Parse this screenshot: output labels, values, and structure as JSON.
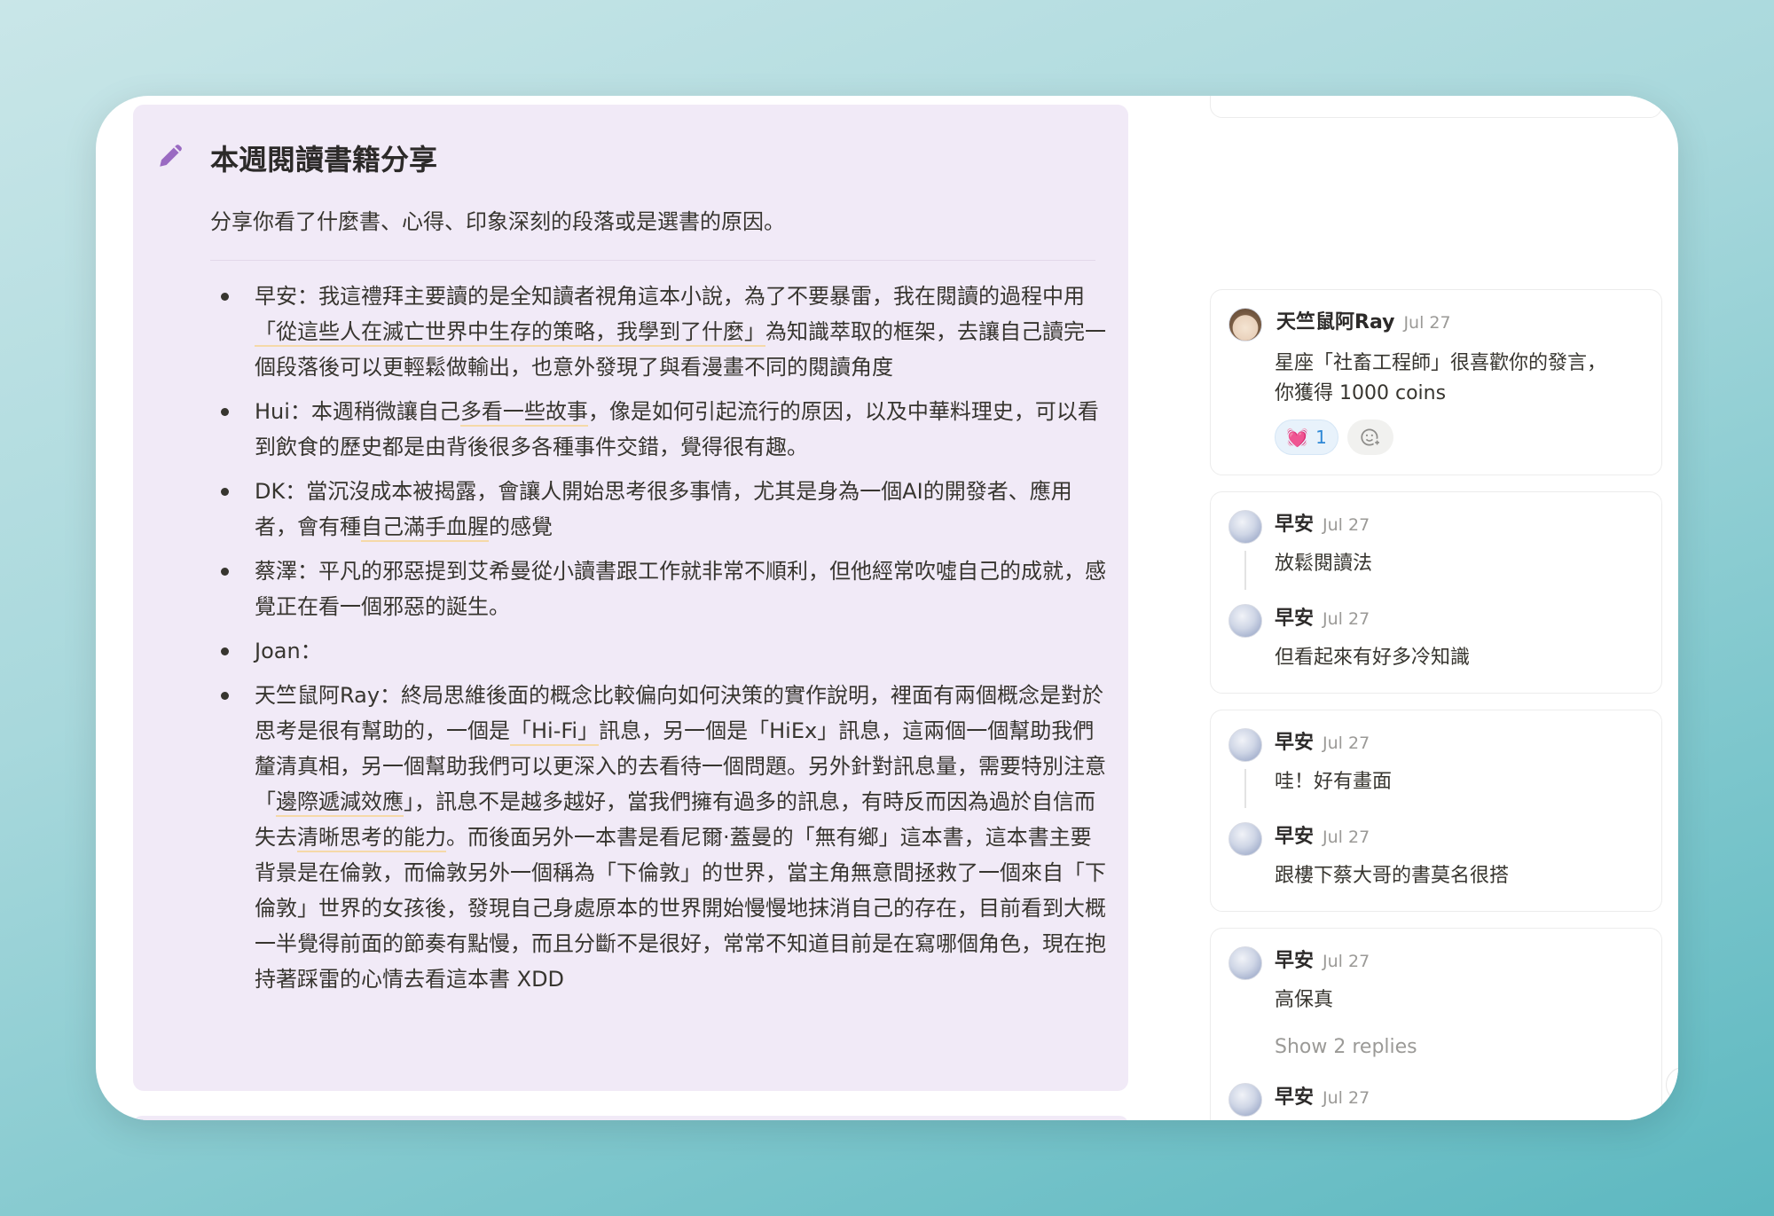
{
  "callout": {
    "title": "本週閱讀書籍分享",
    "subtitle": "分享你看了什麼書、心得、印象深刻的段落或是選書的原因。",
    "icon": "pencil-icon",
    "bullets": [
      {
        "parts": [
          {
            "t": "早安：我這禮拜主要讀的是全知讀者視角這本小說，為了不要暴雷，我在閱讀的過程中用"
          },
          {
            "t": "「從這些人在滅亡世界中生存的策略，我學到了什麼」",
            "h": true
          },
          {
            "t": "為知識萃取的框架，去讓自己讀完一個段落後可以更輕鬆做輸出，也意外發現了與看漫畫不同的閱讀角度"
          }
        ]
      },
      {
        "parts": [
          {
            "t": "Hui：本週稍微讓自己"
          },
          {
            "t": "多看一些故事",
            "h": true
          },
          {
            "t": "，像是如何引起流行的原因，以及中華料理史，可以看到飲食的歷史都是由背後很多各種事件交錯，覺得很有趣。"
          }
        ]
      },
      {
        "parts": [
          {
            "t": "DK：當沉沒成本被揭露，會讓人開始思考很多事情，尤其是身為一個AI的開發者、應用者，會有種"
          },
          {
            "t": "自己滿手血腥",
            "h": true
          },
          {
            "t": "的感覺"
          }
        ]
      },
      {
        "parts": [
          {
            "t": "蔡澤：平凡的邪惡提到艾希曼從小讀書跟工作就非常不順利，但他經常吹噓自己的成就，感覺正在看一個邪惡的誕生。"
          }
        ]
      },
      {
        "parts": [
          {
            "t": "Joan："
          }
        ]
      },
      {
        "parts": [
          {
            "t": "天竺鼠阿Ray：終局思維後面的概念比較偏向如何決策的實作說明，裡面有兩個概念是對於思考是很有幫助的，一個是"
          },
          {
            "t": "「Hi-Fi」",
            "h": true
          },
          {
            "t": "訊息，另一個是「HiEx」訊息，這兩個一個幫助我們釐清真相，另一個幫助我們可以更深入的去看待一個問題。另外針對訊息量，需要特別注意「"
          },
          {
            "t": "邊際遞減效應",
            "h": true
          },
          {
            "t": "」，訊息不是越多越好，當我們擁有過多的訊息，有時反而因為過於自信而失去"
          },
          {
            "t": "清晰思考的能力",
            "h": true
          },
          {
            "t": "。而後面另外一本書是看尼爾·蓋曼的「無有鄉」這本書，這本書主要背景是在倫敦，而倫敦另外一個稱為「下倫敦」的世界，當主角無意間拯救了一個來自「下倫敦」世界的女孩後，發現自己身處原本的世界開始慢慢地抹消自己的存在，目前看到大概一半覺得前面的節奏有點慢，而且分斷不是很好，常常不知道目前是在寫哪個角色，現在抱持著踩雷的心情去看這本書 XDD"
          }
        ]
      }
    ]
  },
  "comments": {
    "card1": {
      "author": "天竺鼠阿Ray",
      "date": "Jul 27",
      "text_line1": "星座「社畜工程師」很喜歡你的發言，",
      "text_line2": "你獲得 1000 coins",
      "reaction_emoji": "💓",
      "reaction_count": "1",
      "add_reaction_icon": "add-reaction-icon"
    },
    "card2": [
      {
        "author": "早安",
        "date": "Jul 27",
        "text": "放鬆閱讀法"
      },
      {
        "author": "早安",
        "date": "Jul 27",
        "text": "但看起來有好多冷知識"
      }
    ],
    "card3": [
      {
        "author": "早安",
        "date": "Jul 27",
        "text": "哇！好有畫面"
      },
      {
        "author": "早安",
        "date": "Jul 27",
        "text": "跟樓下蔡大哥的書莫名很搭"
      }
    ],
    "card4": {
      "author": "早安",
      "date": "Jul 27",
      "text": "高保真",
      "show_replies": "Show 2 replies",
      "last_author": "早安",
      "last_date": "Jul 27"
    }
  }
}
